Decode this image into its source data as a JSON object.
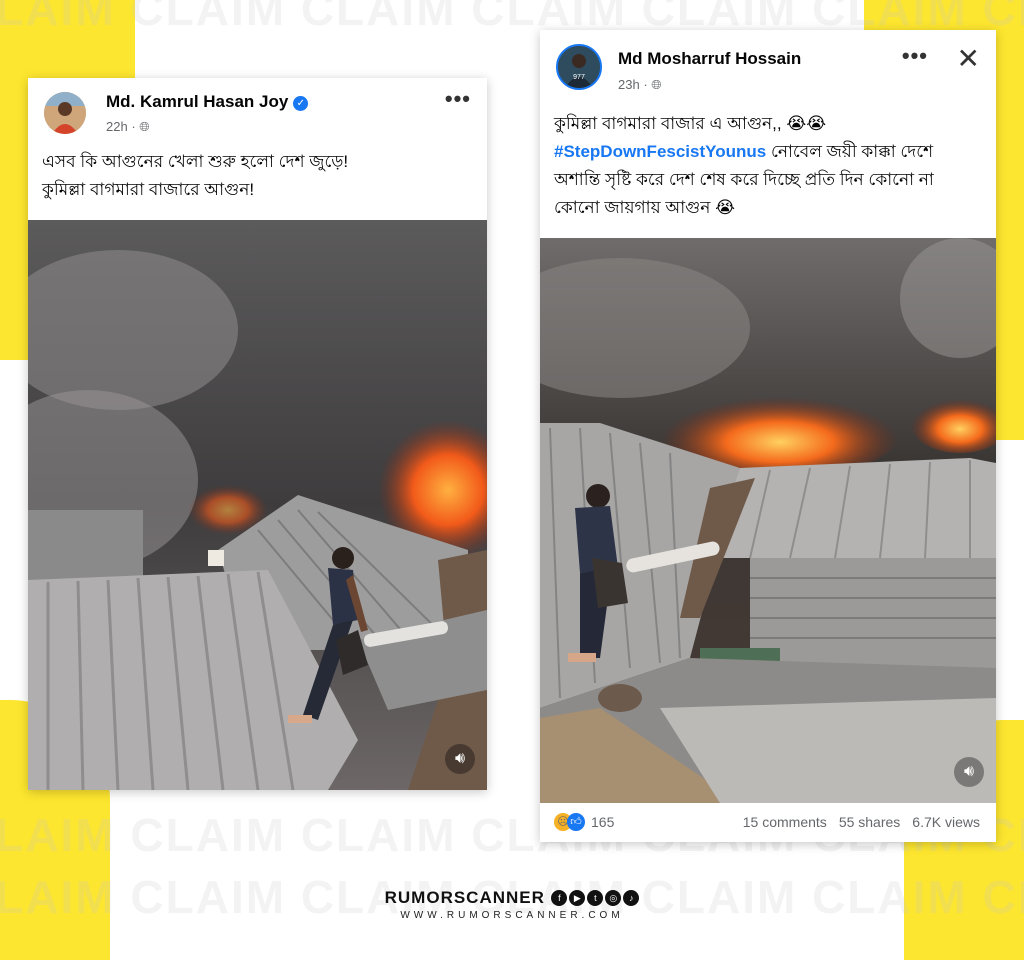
{
  "colors": {
    "brand_yellow": "#fde62f",
    "link_blue": "#1877f2",
    "fire": "#ff5a1c"
  },
  "watermark_text": "CLAIM CLAIM CLAIM CLAIM CLAIM CLAIM CLAIM",
  "left_post": {
    "author": "Md. Kamrul Hasan Joy",
    "verified_icon": "verified-badge-icon",
    "time": "22h",
    "privacy_icon": "globe-icon",
    "more_label": "•••",
    "text_line1": "এসব কি আগুনের খেলা শুরু হলো দেশ জুড়ে!",
    "text_line2": "কুমিল্লা বাগমারা বাজারে আগুন!",
    "speaker_icon": "volume-icon"
  },
  "right_post": {
    "author": "Md Mosharruf Hossain",
    "time": "23h",
    "privacy_icon": "globe-icon",
    "more_label": "•••",
    "close_label": "✕",
    "text_line1": "কুমিল্লা বাগমারা বাজার এ আগুন,, 😭😭",
    "hashtag": "#StepDownFescistYounus",
    "text_after_hashtag": " নোবেল জয়ী কাক্কা দেশে অশান্তি সৃষ্টি করে দেশ শেষ করে দিচ্ছে প্রতি দিন কোনো না কোনো জায়গায় আগুন 😭",
    "speaker_icon": "volume-icon",
    "reaction_count": "165",
    "comments": "15 comments",
    "shares": "55 shares",
    "views": "6.7K views"
  },
  "brand": {
    "name": "RUMORSCANNER",
    "url": "WWW.RUMORSCANNER.COM"
  }
}
